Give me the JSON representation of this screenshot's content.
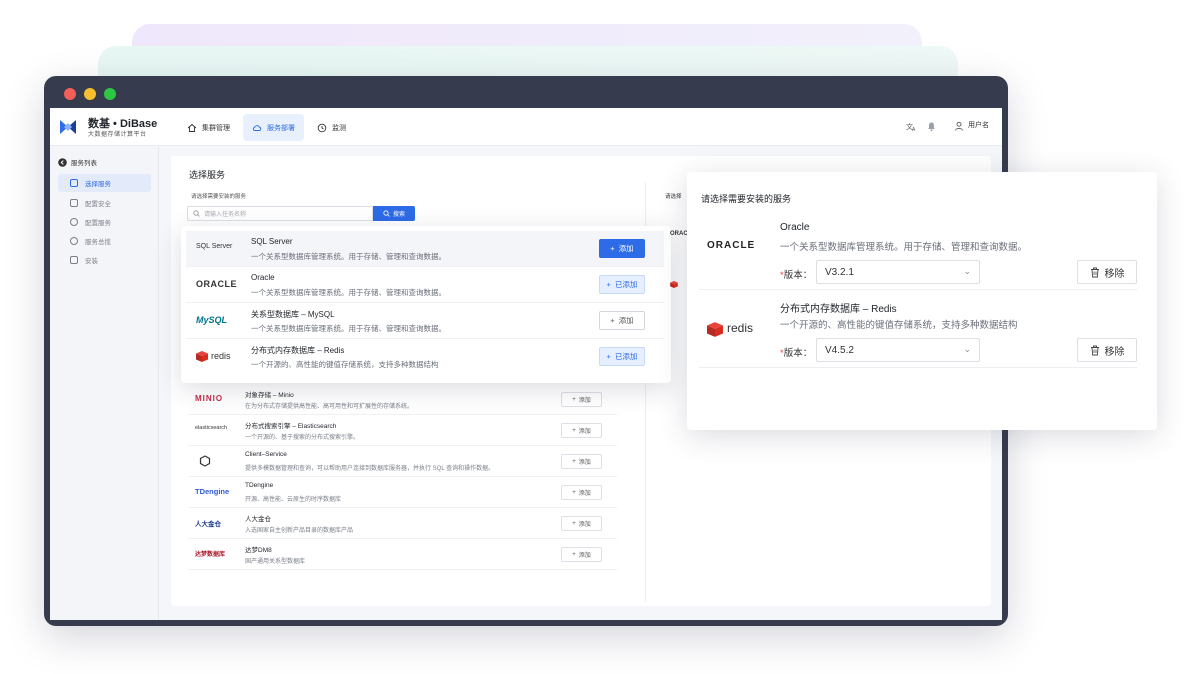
{
  "app": {
    "brand": "数基 • DiBase",
    "brand_sub": "大数据存储计算平台",
    "user": "用户名"
  },
  "nav": {
    "items": [
      {
        "label": "集群管理",
        "icon": "home-icon"
      },
      {
        "label": "服务部署",
        "icon": "cloud-icon"
      },
      {
        "label": "监测",
        "icon": "monitor-icon"
      }
    ]
  },
  "sidebar": {
    "title": "服务列表",
    "items": [
      {
        "label": "选择服务"
      },
      {
        "label": "配置安全"
      },
      {
        "label": "配置服务"
      },
      {
        "label": "服务总揽"
      },
      {
        "label": "安装"
      }
    ]
  },
  "main": {
    "title": "选择服务",
    "sub_label": "请选择需要安装的服务",
    "search_placeholder": "请输入任务名称",
    "search_button": "搜索",
    "right_hint": "请选择",
    "services": [
      {
        "logo": "MINIO",
        "name": "对象存储 – Minio",
        "desc": "在为分布式存储提供高性能、高可用性和可扩展性的存储系统。",
        "button": "添加"
      },
      {
        "logo": "elasticsearch",
        "name": "分布式搜索引擎 – Elasticsearch",
        "desc": "一个开源的、基于搜索的分布式搜索引擎。",
        "button": "添加"
      },
      {
        "logo": "Client",
        "name": "Client–Service",
        "desc": "提供多模数据管理和查询，可以帮助用户连接到数据库服务器，并执行 SQL 查询和操作数据。",
        "button": "添加"
      },
      {
        "logo": "TDengine",
        "name": "TDengine",
        "desc": "开源、高性能、云原生的时序数据库",
        "button": "添加"
      },
      {
        "logo": "人大金仓",
        "name": "人大金仓",
        "desc": "入选国家自主创新产品目录的数据库产品",
        "button": "添加"
      },
      {
        "logo": "达梦数据库",
        "name": "达梦DM8",
        "desc": "国产通用关系型数据库",
        "button": "添加"
      }
    ]
  },
  "popup_left": {
    "rows": [
      {
        "logo": "SQL Server",
        "name": "SQL Server",
        "desc": "一个关系型数据库管理系统。用于存储、管理和查询数据。",
        "button": "添加",
        "state": "primary"
      },
      {
        "logo": "ORACLE",
        "name": "Oracle",
        "desc": "一个关系型数据库管理系统。用于存储、管理和查询数据。",
        "button": "已添加",
        "state": "added"
      },
      {
        "logo": "MySQL",
        "name": "关系型数据库 – MySQL",
        "desc": "一个关系型数据库管理系统。用于存储、管理和查询数据。",
        "button": "添加",
        "state": "plain"
      },
      {
        "logo": "redis",
        "name": "分布式内存数据库 – Redis",
        "desc": "一个开源的、高性能的键值存储系统，支持多种数据结构",
        "button": "已添加",
        "state": "added"
      }
    ]
  },
  "popup_right": {
    "title": "请选择需要安装的服务",
    "version_label": "版本：",
    "remove_label": "移除",
    "selected": [
      {
        "logo": "ORACLE",
        "name": "Oracle",
        "desc": "一个关系型数据库管理系统。用于存储、管理和查询数据。",
        "version": "V3.2.1"
      },
      {
        "logo": "redis",
        "name": "分布式内存数据库 – Redis",
        "desc": "一个开源的、高性能的键值存储系统，支持多种数据结构",
        "version": "V4.5.2"
      }
    ]
  },
  "colors": {
    "accent": "#2e6be6",
    "oracle_red": "#c74634",
    "redis_red": "#d82c20"
  }
}
